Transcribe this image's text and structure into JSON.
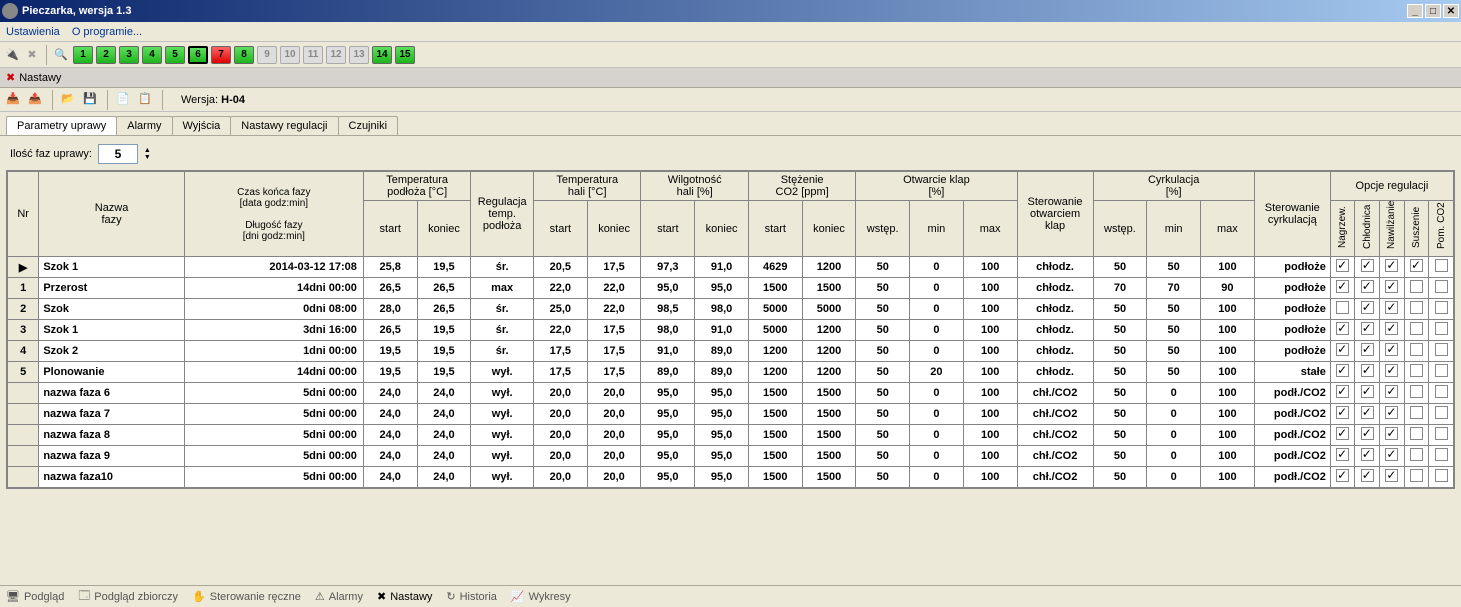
{
  "title": "Pieczarka, wersja 1.3",
  "menu": {
    "settings": "Ustawienia",
    "about": "O programie..."
  },
  "panel_title": "Nastawy",
  "version_label": "Wersja:",
  "version": "H-04",
  "tabs": [
    "Parametry uprawy",
    "Alarmy",
    "Wyjścia",
    "Nastawy regulacji",
    "Czujniki"
  ],
  "phase_count_label": "Ilość faz uprawy:",
  "phase_count": "5",
  "hdr": {
    "nr": "Nr",
    "name": "Nazwa\nfazy",
    "time": "Czas końca fazy\n[data godz:min]\n\nDługość fazy\n[dni godz:min]",
    "tp": "Temperatura\npodłoża [°C]",
    "reg": "Regulacja\ntemp.\npodłoża",
    "th": "Temperatura\nhali [°C]",
    "wh": "Wilgotność\nhali [%]",
    "co2": "Stężenie\nCO2 [ppm]",
    "klap": "Otwarcie klap\n[%]",
    "stklap": "Sterowanie\notwarciem\nklap",
    "cyrk": "Cyrkulacja\n[%]",
    "stcyrk": "Sterowanie\ncyrkulacją",
    "opcje": "Opcje regulacji",
    "start": "start",
    "koniec": "koniec",
    "wstep": "wstęp.",
    "min": "min",
    "max": "max",
    "o1": "Nagrzew.",
    "o2": "Chłodnica",
    "o3": "Nawilżanie",
    "o4": "Suszenie",
    "o5": "Pom. CO2"
  },
  "numbtns": [
    {
      "n": "1",
      "s": "g"
    },
    {
      "n": "2",
      "s": "g"
    },
    {
      "n": "3",
      "s": "g"
    },
    {
      "n": "4",
      "s": "g"
    },
    {
      "n": "5",
      "s": "g"
    },
    {
      "n": "6",
      "s": "g",
      "active": true
    },
    {
      "n": "7",
      "s": "r"
    },
    {
      "n": "8",
      "s": "g"
    },
    {
      "n": "9",
      "s": "o"
    },
    {
      "n": "10",
      "s": "o"
    },
    {
      "n": "11",
      "s": "o"
    },
    {
      "n": "12",
      "s": "o"
    },
    {
      "n": "13",
      "s": "o"
    },
    {
      "n": "14",
      "s": "g"
    },
    {
      "n": "15",
      "s": "g"
    }
  ],
  "rows": [
    {
      "sel": "▶",
      "name": "Szok 1",
      "time": "2014-03-12 17:08",
      "tp": [
        "25,8",
        "19,5"
      ],
      "reg": "śr.",
      "th": [
        "20,5",
        "17,5"
      ],
      "wh": [
        "97,3",
        "91,0"
      ],
      "co2": [
        "4629",
        "1200"
      ],
      "klap": [
        "50",
        "0",
        "100"
      ],
      "stk": "chłodz.",
      "cyrk": [
        "50",
        "50",
        "100"
      ],
      "stc": "podłoże",
      "op": [
        1,
        1,
        1,
        1,
        0
      ]
    },
    {
      "sel": "1",
      "name": "Przerost",
      "time": "14dni 00:00",
      "tp": [
        "26,5",
        "26,5"
      ],
      "reg": "max",
      "th": [
        "22,0",
        "22,0"
      ],
      "wh": [
        "95,0",
        "95,0"
      ],
      "co2": [
        "1500",
        "1500"
      ],
      "klap": [
        "50",
        "0",
        "100"
      ],
      "stk": "chłodz.",
      "cyrk": [
        "70",
        "70",
        "90"
      ],
      "stc": "podłoże",
      "op": [
        1,
        1,
        1,
        0,
        0
      ]
    },
    {
      "sel": "2",
      "name": "Szok",
      "time": "0dni 08:00",
      "tp": [
        "28,0",
        "26,5"
      ],
      "reg": "śr.",
      "th": [
        "25,0",
        "22,0"
      ],
      "wh": [
        "98,5",
        "98,0"
      ],
      "co2": [
        "5000",
        "5000"
      ],
      "klap": [
        "50",
        "0",
        "100"
      ],
      "stk": "chłodz.",
      "cyrk": [
        "50",
        "50",
        "100"
      ],
      "stc": "podłoże",
      "op": [
        0,
        1,
        1,
        0,
        0
      ]
    },
    {
      "sel": "3",
      "name": "Szok 1",
      "time": "3dni 16:00",
      "tp": [
        "26,5",
        "19,5"
      ],
      "reg": "śr.",
      "th": [
        "22,0",
        "17,5"
      ],
      "wh": [
        "98,0",
        "91,0"
      ],
      "co2": [
        "5000",
        "1200"
      ],
      "klap": [
        "50",
        "0",
        "100"
      ],
      "stk": "chłodz.",
      "cyrk": [
        "50",
        "50",
        "100"
      ],
      "stc": "podłoże",
      "op": [
        1,
        1,
        1,
        0,
        0
      ]
    },
    {
      "sel": "4",
      "name": "Szok 2",
      "time": "1dni 00:00",
      "tp": [
        "19,5",
        "19,5"
      ],
      "reg": "śr.",
      "th": [
        "17,5",
        "17,5"
      ],
      "wh": [
        "91,0",
        "89,0"
      ],
      "co2": [
        "1200",
        "1200"
      ],
      "klap": [
        "50",
        "0",
        "100"
      ],
      "stk": "chłodz.",
      "cyrk": [
        "50",
        "50",
        "100"
      ],
      "stc": "podłoże",
      "op": [
        1,
        1,
        1,
        0,
        0
      ]
    },
    {
      "sel": "5",
      "name": "Plonowanie",
      "time": "14dni 00:00",
      "tp": [
        "19,5",
        "19,5"
      ],
      "reg": "wył.",
      "th": [
        "17,5",
        "17,5"
      ],
      "wh": [
        "89,0",
        "89,0"
      ],
      "co2": [
        "1200",
        "1200"
      ],
      "klap": [
        "50",
        "20",
        "100"
      ],
      "stk": "chłodz.",
      "cyrk": [
        "50",
        "50",
        "100"
      ],
      "stc": "stałe",
      "op": [
        1,
        1,
        1,
        0,
        0
      ]
    },
    {
      "sel": "",
      "name": "nazwa faza 6",
      "time": "5dni 00:00",
      "tp": [
        "24,0",
        "24,0"
      ],
      "reg": "wył.",
      "th": [
        "20,0",
        "20,0"
      ],
      "wh": [
        "95,0",
        "95,0"
      ],
      "co2": [
        "1500",
        "1500"
      ],
      "klap": [
        "50",
        "0",
        "100"
      ],
      "stk": "chł./CO2",
      "cyrk": [
        "50",
        "0",
        "100"
      ],
      "stc": "podł./CO2",
      "op": [
        1,
        1,
        1,
        0,
        0
      ]
    },
    {
      "sel": "",
      "name": "nazwa faza 7",
      "time": "5dni 00:00",
      "tp": [
        "24,0",
        "24,0"
      ],
      "reg": "wył.",
      "th": [
        "20,0",
        "20,0"
      ],
      "wh": [
        "95,0",
        "95,0"
      ],
      "co2": [
        "1500",
        "1500"
      ],
      "klap": [
        "50",
        "0",
        "100"
      ],
      "stk": "chł./CO2",
      "cyrk": [
        "50",
        "0",
        "100"
      ],
      "stc": "podł./CO2",
      "op": [
        1,
        1,
        1,
        0,
        0
      ]
    },
    {
      "sel": "",
      "name": "nazwa faza 8",
      "time": "5dni 00:00",
      "tp": [
        "24,0",
        "24,0"
      ],
      "reg": "wył.",
      "th": [
        "20,0",
        "20,0"
      ],
      "wh": [
        "95,0",
        "95,0"
      ],
      "co2": [
        "1500",
        "1500"
      ],
      "klap": [
        "50",
        "0",
        "100"
      ],
      "stk": "chł./CO2",
      "cyrk": [
        "50",
        "0",
        "100"
      ],
      "stc": "podł./CO2",
      "op": [
        1,
        1,
        1,
        0,
        0
      ]
    },
    {
      "sel": "",
      "name": "nazwa faza 9",
      "time": "5dni 00:00",
      "tp": [
        "24,0",
        "24,0"
      ],
      "reg": "wył.",
      "th": [
        "20,0",
        "20,0"
      ],
      "wh": [
        "95,0",
        "95,0"
      ],
      "co2": [
        "1500",
        "1500"
      ],
      "klap": [
        "50",
        "0",
        "100"
      ],
      "stk": "chł./CO2",
      "cyrk": [
        "50",
        "0",
        "100"
      ],
      "stc": "podł./CO2",
      "op": [
        1,
        1,
        1,
        0,
        0
      ]
    },
    {
      "sel": "",
      "name": "nazwa faza10",
      "time": "5dni 00:00",
      "tp": [
        "24,0",
        "24,0"
      ],
      "reg": "wył.",
      "th": [
        "20,0",
        "20,0"
      ],
      "wh": [
        "95,0",
        "95,0"
      ],
      "co2": [
        "1500",
        "1500"
      ],
      "klap": [
        "50",
        "0",
        "100"
      ],
      "stk": "chł./CO2",
      "cyrk": [
        "50",
        "0",
        "100"
      ],
      "stc": "podł./CO2",
      "op": [
        1,
        1,
        1,
        0,
        0
      ]
    }
  ],
  "status": [
    {
      "icon": "🖥",
      "label": "Podgląd"
    },
    {
      "icon": "🗔",
      "label": "Podgląd zbiorczy"
    },
    {
      "icon": "✋",
      "label": "Sterowanie ręczne"
    },
    {
      "icon": "⚠",
      "label": "Alarmy"
    },
    {
      "icon": "✖",
      "label": "Nastawy"
    },
    {
      "icon": "↻",
      "label": "Historia"
    },
    {
      "icon": "📈",
      "label": "Wykresy"
    }
  ]
}
